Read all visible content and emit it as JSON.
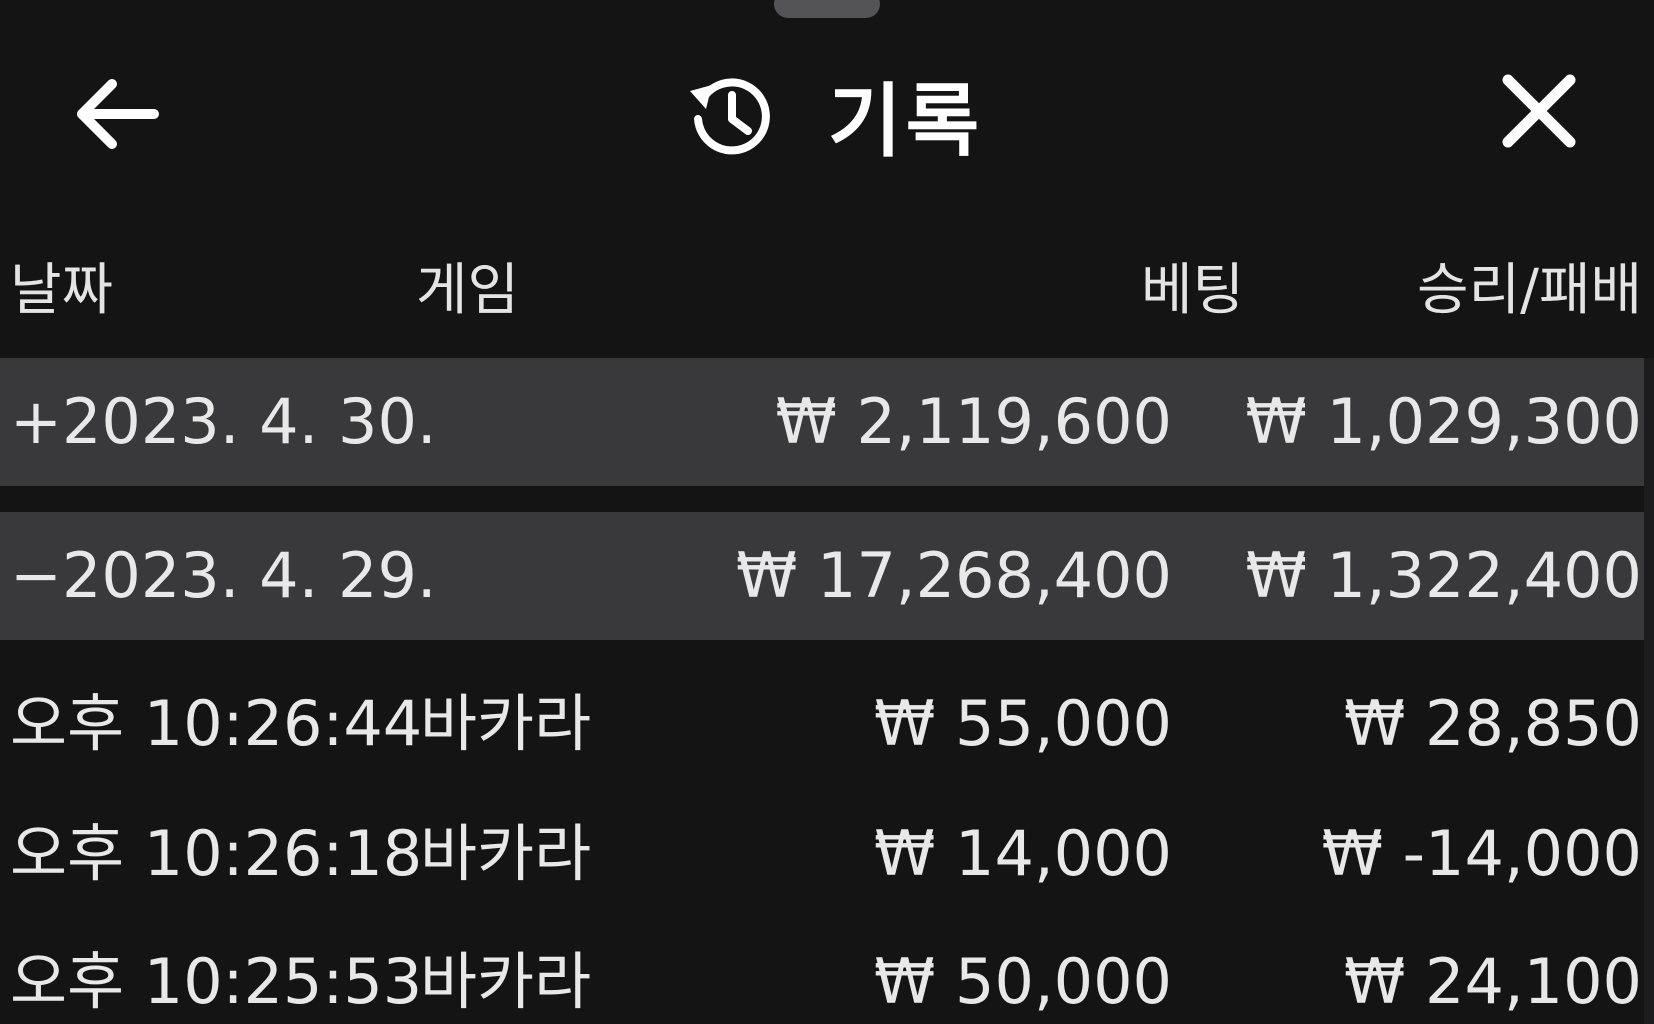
{
  "header": {
    "title": "기록",
    "back_icon": "arrow-left-icon",
    "title_icon": "history-icon",
    "close_icon": "close-icon"
  },
  "columns": {
    "date": "날짜",
    "game": "게임",
    "bet": "베팅",
    "result": "승리/패배"
  },
  "groups": [
    {
      "date": "+2023. 4. 30.",
      "bet": "₩ 2,119,600",
      "result": "₩ 1,029,300",
      "expanded": false
    },
    {
      "date": "−2023. 4. 29.",
      "bet": "₩ 17,268,400",
      "result": "₩ 1,322,400",
      "expanded": true
    }
  ],
  "entries": [
    {
      "time": "오후 10:26:44",
      "game": "바카라",
      "bet": "₩ 55,000",
      "result": "₩ 28,850"
    },
    {
      "time": "오후 10:26:18",
      "game": "바카라",
      "bet": "₩ 14,000",
      "result": "₩ -14,000"
    },
    {
      "time": "오후 10:25:53",
      "game": "바카라",
      "bet": "₩ 50,000",
      "result": "₩ 24,100"
    }
  ],
  "colors": {
    "background": "#141415",
    "group_row": "#39393b",
    "text": "#e8e8e8",
    "title": "#ffffff"
  }
}
